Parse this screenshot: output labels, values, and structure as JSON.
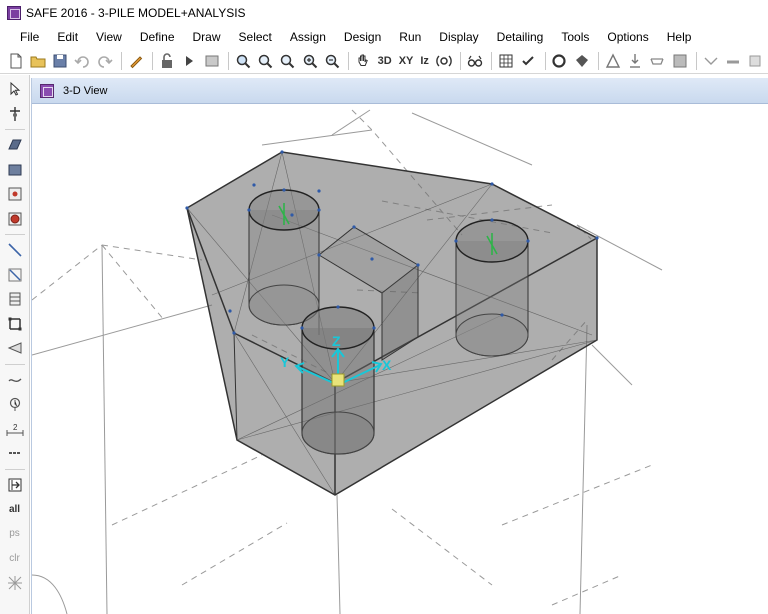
{
  "window": {
    "title": "SAFE 2016 - 3-PILE MODEL+ANALYSIS"
  },
  "menu": [
    "File",
    "Edit",
    "View",
    "Define",
    "Draw",
    "Select",
    "Assign",
    "Design",
    "Run",
    "Display",
    "Detailing",
    "Tools",
    "Options",
    "Help"
  ],
  "toolbar": {
    "view_3d_label": "3D",
    "view_xy_label": "XY",
    "view_rotate_z_label": "Iz"
  },
  "left_toolbar": {
    "select_all_label": "all",
    "previous_selection_label": "ps",
    "clear_selection_label": "clr"
  },
  "view": {
    "title": "3-D View",
    "axes": {
      "x": "X",
      "y": "Y",
      "z": "Z"
    }
  }
}
